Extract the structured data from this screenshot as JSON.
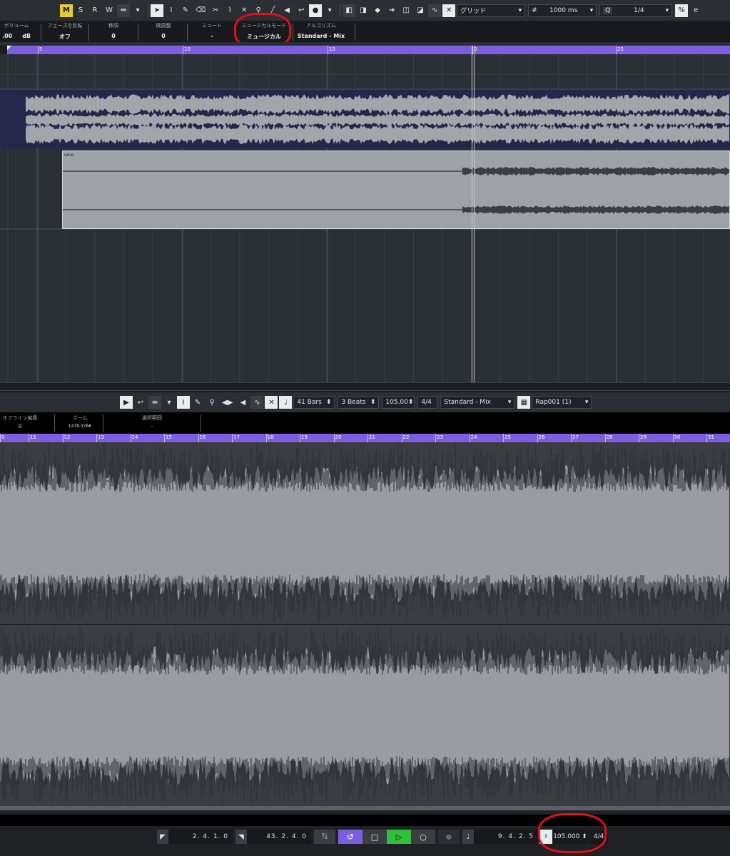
{
  "top_toolbar": {
    "mode_buttons": [
      "M",
      "S",
      "R",
      "W"
    ],
    "snap_type": "グリッド",
    "grid_value": "1000 ms",
    "quantize_label": "Q",
    "quantize_value": "1/4"
  },
  "info_line": [
    {
      "label": "ボリューム",
      "value": ".00",
      "unit": "dB"
    },
    {
      "label": "フェーズを反転",
      "value": "オフ"
    },
    {
      "label": "移調",
      "value": "0"
    },
    {
      "label": "微調整",
      "value": "0"
    },
    {
      "label": "ミュート",
      "value": "-"
    },
    {
      "label": "ミュージカルモード",
      "value": "ミュージカル"
    },
    {
      "label": "アルゴリズム",
      "value": "Standard - Mix"
    }
  ],
  "project_ruler": [
    "5",
    "10",
    "15",
    "0",
    "25"
  ],
  "event_label": "ume",
  "editor_toolbar": {
    "audio_length": "41 Bars",
    "beats": "3 Beats",
    "tempo": "105.00",
    "signature": "4/4",
    "algorithm": "Standard - Mix",
    "clip_name": "Rap001 (1)"
  },
  "editor_info": [
    {
      "label": "オフライン編集",
      "value": "0"
    },
    {
      "label": "ズーム",
      "value": "1479.3766"
    },
    {
      "label": "選択範囲",
      "value": "-"
    }
  ],
  "editor_ruler": [
    "0",
    "11",
    "12",
    "13",
    "14",
    "15",
    "16",
    "17",
    "18",
    "19",
    "20",
    "21",
    "22",
    "23",
    "24",
    "25",
    "26",
    "27",
    "28",
    "29",
    "30",
    "31"
  ],
  "transport": {
    "left_locator": "2. 4. 1.  0",
    "right_locator": "43. 2. 4.  0",
    "position": "9. 4. 2.  5",
    "tempo": "105.000",
    "signature": "4/4"
  },
  "colors": {
    "accent": "#7b5fe0",
    "play": "#2fbf3a",
    "annotation": "#e0101a",
    "mode_active": "#e6c93a"
  }
}
